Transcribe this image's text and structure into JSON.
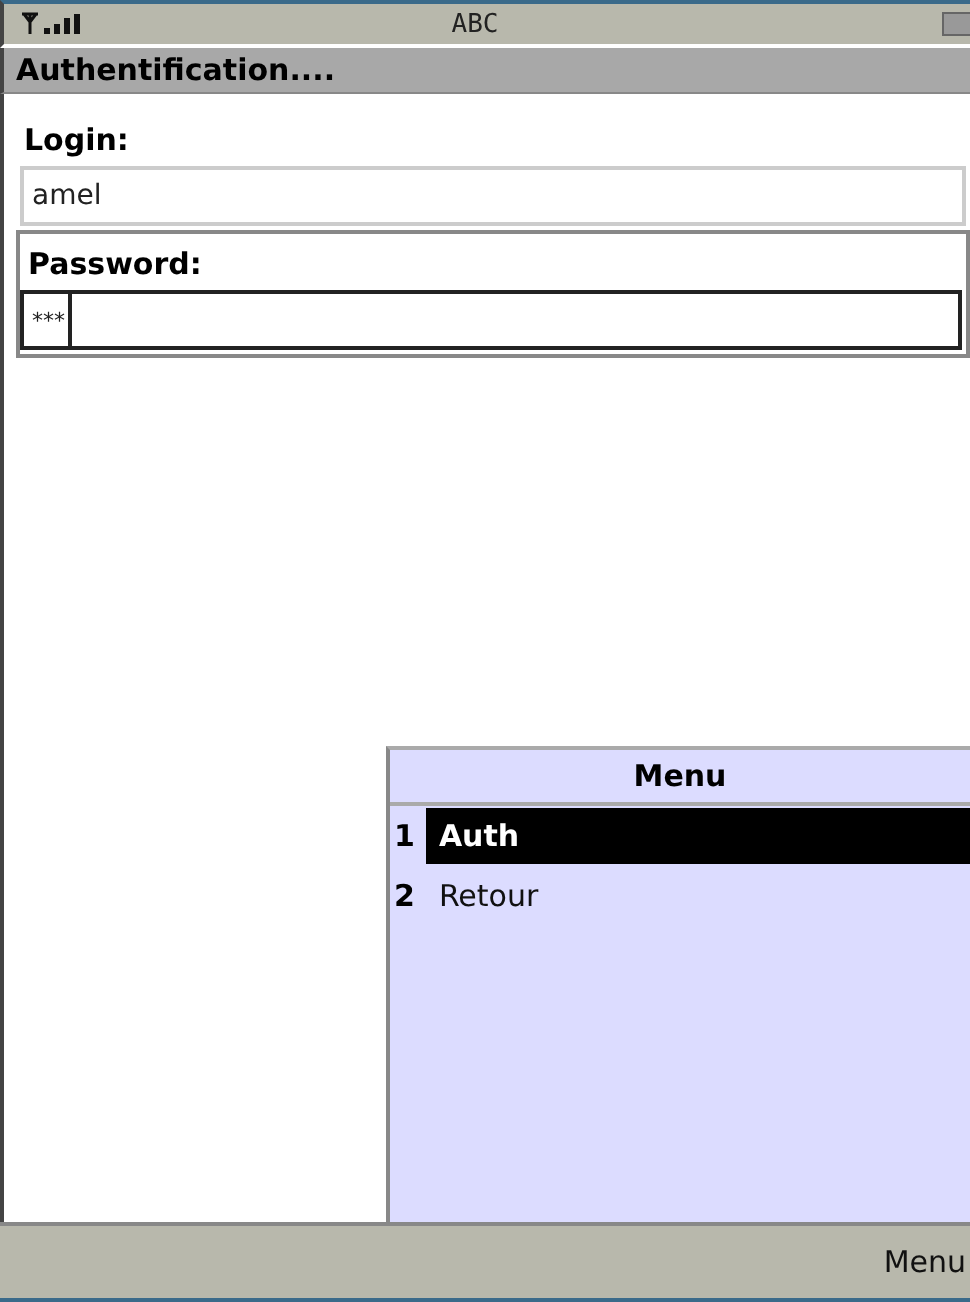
{
  "status_bar": {
    "input_mode": "ABC"
  },
  "title": "Authentification....",
  "form": {
    "fields": [
      {
        "label": "Login:",
        "value": "amel",
        "focused": false
      },
      {
        "label": "Password:",
        "value": "***",
        "focused": true
      }
    ]
  },
  "menu": {
    "title": "Menu",
    "items": [
      {
        "number": "1",
        "label": "Auth",
        "selected": true
      },
      {
        "number": "2",
        "label": "Retour",
        "selected": false
      }
    ]
  },
  "softkeys": {
    "right": "Menu"
  }
}
